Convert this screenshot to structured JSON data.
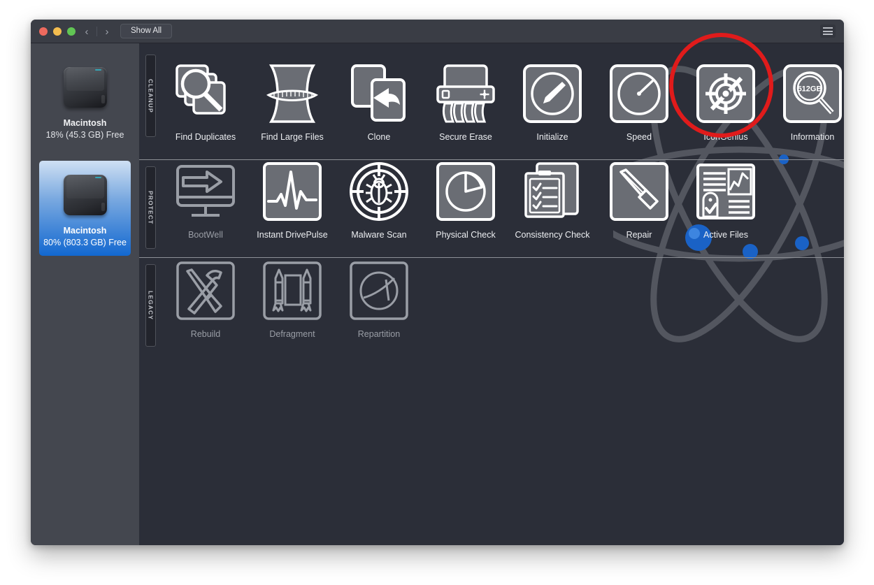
{
  "window": {
    "titlebar": {
      "traffic_lights": [
        "close",
        "minimize",
        "zoom"
      ],
      "back_label": "‹",
      "forward_label": "›",
      "show_all_label": "Show All",
      "listview_icon": "list-view-icon"
    }
  },
  "sidebar": {
    "disks": [
      {
        "name": "Macintosh",
        "free": "18% (45.3 GB) Free",
        "selected": false
      },
      {
        "name": "Macintosh",
        "free": "80% (803.3 GB) Free",
        "selected": true
      }
    ]
  },
  "categories": [
    {
      "label": "CLEANUP"
    },
    {
      "label": "PROTECT"
    },
    {
      "label": "LEGACY"
    }
  ],
  "tools": {
    "cleanup": [
      {
        "label": "Find Duplicates",
        "icon": "find-duplicates-icon",
        "enabled": true
      },
      {
        "label": "Find Large Files",
        "icon": "measuring-tape-icon",
        "enabled": true
      },
      {
        "label": "Clone",
        "icon": "clone-icon",
        "enabled": true
      },
      {
        "label": "Secure Erase",
        "icon": "shredder-icon",
        "enabled": true
      },
      {
        "label": "Initialize",
        "icon": "pencil-circle-icon",
        "enabled": true
      },
      {
        "label": "Speed",
        "icon": "gauge-icon",
        "enabled": true
      },
      {
        "label": "IconGenius",
        "icon": "target-crosshair-icon",
        "enabled": true
      },
      {
        "label": "Information",
        "icon": "magnifier-capacity-icon",
        "enabled": true,
        "icon_text": "512GB"
      }
    ],
    "protect": [
      {
        "label": "BootWell",
        "icon": "monitor-arrow-icon",
        "enabled": false
      },
      {
        "label": "Instant DrivePulse",
        "icon": "pulse-waveform-icon",
        "enabled": true
      },
      {
        "label": "Malware Scan",
        "icon": "bug-crosshair-icon",
        "enabled": true
      },
      {
        "label": "Physical Check",
        "icon": "pie-chart-icon",
        "enabled": true
      },
      {
        "label": "Consistency Check",
        "icon": "checklist-icon",
        "enabled": true
      },
      {
        "label": "Repair",
        "icon": "screwdriver-icon",
        "enabled": true
      },
      {
        "label": "Active Files",
        "icon": "report-tag-icon",
        "enabled": true
      }
    ],
    "legacy": [
      {
        "label": "Rebuild",
        "icon": "hammer-screwdriver-icon",
        "enabled": false
      },
      {
        "label": "Defragment",
        "icon": "rockets-icon",
        "enabled": false
      },
      {
        "label": "Repartition",
        "icon": "partition-circle-icon",
        "enabled": false
      }
    ]
  },
  "annotation": {
    "type": "red-ellipse",
    "target": "IconGenius",
    "color": "#e01b1b"
  },
  "colors": {
    "window_bg": "#2b2e38",
    "titlebar_bg": "#3a3d45",
    "sidebar_bg": "#44474f",
    "accent_selected": "#1268d0",
    "icon_stroke": "#ffffff",
    "icon_stroke_disabled": "#9a9ea6",
    "icon_fill": "#6a6d74",
    "annotation": "#e01b1b"
  }
}
